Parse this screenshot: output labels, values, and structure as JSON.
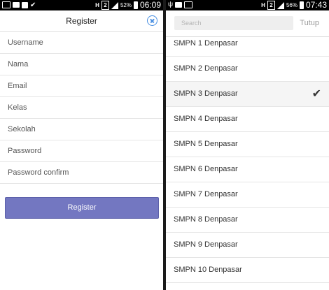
{
  "left_screen": {
    "status": {
      "battery_percent": "52%",
      "time": "06:09",
      "network": "H",
      "sim": "2"
    },
    "title": "Register",
    "fields": [
      {
        "placeholder": "Username"
      },
      {
        "placeholder": "Nama"
      },
      {
        "placeholder": "Email"
      },
      {
        "placeholder": "Kelas"
      },
      {
        "placeholder": "Sekolah"
      },
      {
        "placeholder": "Password"
      },
      {
        "placeholder": "Password confirm"
      }
    ],
    "register_button": "Register"
  },
  "right_screen": {
    "status": {
      "battery_percent": "56%",
      "time": "07:43",
      "network": "H",
      "sim": "2"
    },
    "search_placeholder": "Search",
    "cancel_label": "Tutup",
    "schools": [
      {
        "name": "SMPN 1 Denpasar",
        "selected": false
      },
      {
        "name": "SMPN 2 Denpasar",
        "selected": false
      },
      {
        "name": "SMPN 3 Denpasar",
        "selected": true
      },
      {
        "name": "SMPN 4 Denpasar",
        "selected": false
      },
      {
        "name": "SMPN 5 Denpasar",
        "selected": false
      },
      {
        "name": "SMPN 6 Denpasar",
        "selected": false
      },
      {
        "name": "SMPN 7 Denpasar",
        "selected": false
      },
      {
        "name": "SMPN 8 Denpasar",
        "selected": false
      },
      {
        "name": "SMPN 9 Denpasar",
        "selected": false
      },
      {
        "name": "SMPN 10 Denpasar",
        "selected": false
      }
    ]
  },
  "colors": {
    "accent": "#7377c1",
    "close_icon": "#4a90e2"
  },
  "icons": {
    "selected": "checkmark-icon",
    "close": "close-circle-icon"
  }
}
